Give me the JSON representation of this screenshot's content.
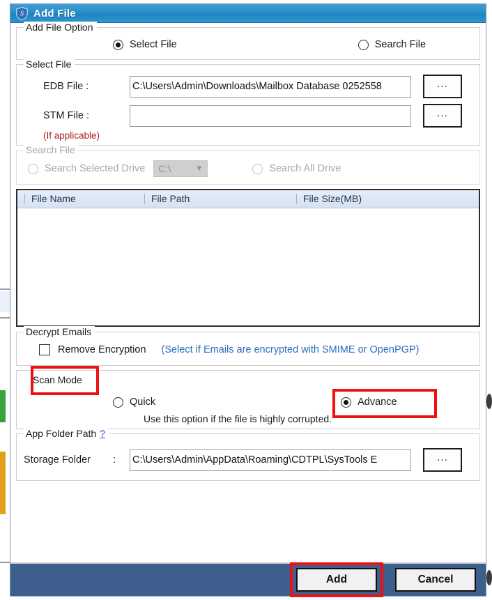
{
  "window": {
    "title": "Add File",
    "icon": "shield-s-icon",
    "titlebar_color": "#2a8ec9",
    "footer_color": "#3e5f8e"
  },
  "add_file_option": {
    "legend": "Add File Option",
    "options": [
      {
        "label": "Select File",
        "selected": true
      },
      {
        "label": "Search File",
        "selected": false
      }
    ]
  },
  "select_file": {
    "legend": "Select File",
    "edb": {
      "label": "EDB File :",
      "value": "C:\\Users\\Admin\\Downloads\\Mailbox Database 0252558",
      "browse_label": "..."
    },
    "stm": {
      "label": "STM File :",
      "value": "",
      "placeholder": "",
      "note": "(If applicable)",
      "note_color": "#b02020",
      "browse_label": "..."
    }
  },
  "search_file": {
    "legend": "Search File",
    "disabled": true,
    "selected_drive_option": {
      "label": "Search Selected Drive",
      "selected": false
    },
    "drive_combo": {
      "value": "C:\\",
      "chevron": "chevron-down-icon"
    },
    "all_drive_option": {
      "label": "Search All Drive",
      "selected": false
    }
  },
  "file_list": {
    "columns": [
      "File Name",
      "File Path",
      "File Size(MB)"
    ],
    "rows": []
  },
  "decrypt_emails": {
    "legend": "Decrypt Emails",
    "checkbox_label": "Remove Encryption",
    "checked": false,
    "hint": "(Select if Emails are encrypted with SMIME or OpenPGP)",
    "hint_color": "#2a6fc4"
  },
  "scan_mode": {
    "legend": "Scan Mode",
    "options": [
      {
        "label": "Quick",
        "selected": false
      },
      {
        "label": "Advance",
        "selected": true
      }
    ],
    "note": "Use this option if the file is highly corrupted.",
    "highlight_color": "#ee1111"
  },
  "app_folder_path": {
    "legend": "App Folder Path",
    "help_link": "?",
    "storage_label": "Storage Folder",
    "storage_colon": ":",
    "storage_value": "C:\\Users\\Admin\\AppData\\Roaming\\CDTPL\\SysTools E",
    "browse_label": "..."
  },
  "footer": {
    "add_label": "Add",
    "cancel_label": "Cancel"
  }
}
